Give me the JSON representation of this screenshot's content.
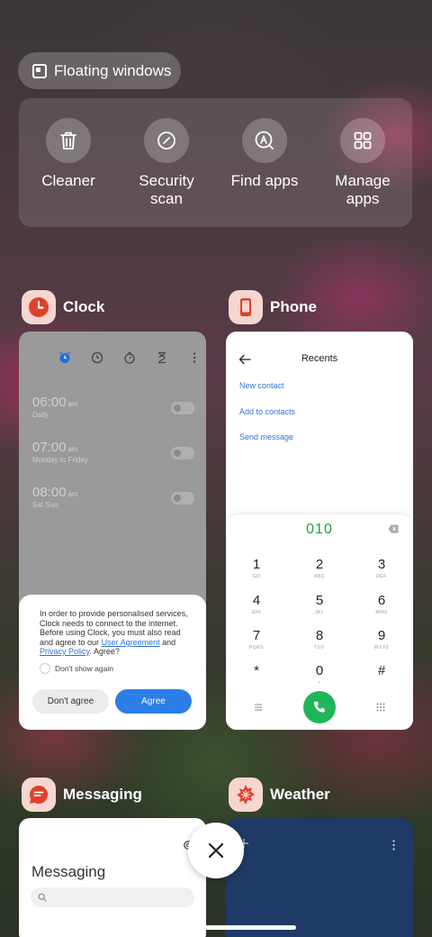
{
  "floating_windows": {
    "label": "Floating windows",
    "icon": "floating-window-icon"
  },
  "quick_actions": [
    {
      "label": "Cleaner",
      "icon": "trash-icon"
    },
    {
      "label": "Security\nscan",
      "icon": "security-scan-icon"
    },
    {
      "label": "Find apps",
      "icon": "find-apps-icon"
    },
    {
      "label": "Manage\napps",
      "icon": "grid-icon"
    }
  ],
  "apps": {
    "clock": {
      "name": "Clock",
      "icon": "clock-icon",
      "alarms": [
        {
          "time": "06:00",
          "ampm": "am",
          "repeat": "Daily"
        },
        {
          "time": "07:00",
          "ampm": "am",
          "repeat": "Monday to Friday"
        },
        {
          "time": "08:00",
          "ampm": "am",
          "repeat": "Sat Sun"
        }
      ],
      "consent": {
        "text_before": "In order to provide personalised services, Clock needs to connect to the internet. Before using Clock, you must also read and agree to our ",
        "link1": "User Agreement",
        "and": " and ",
        "link2": "Privacy Policy",
        "text_after": ". Agree?",
        "checkbox": "Don't show again",
        "decline": "Don't agree",
        "accept": "Agree"
      }
    },
    "phone": {
      "name": "Phone",
      "icon": "phone-icon",
      "title": "Recents",
      "links": [
        "New contact",
        "Add to contacts",
        "Send message"
      ],
      "dialed": "010",
      "keys": [
        {
          "d": "1",
          "l": "GD"
        },
        {
          "d": "2",
          "l": "ABC"
        },
        {
          "d": "3",
          "l": "DEF"
        },
        {
          "d": "4",
          "l": "GHI"
        },
        {
          "d": "5",
          "l": "JKL"
        },
        {
          "d": "6",
          "l": "MNO"
        },
        {
          "d": "7",
          "l": "PQRS"
        },
        {
          "d": "8",
          "l": "TUV"
        },
        {
          "d": "9",
          "l": "WXYZ"
        },
        {
          "d": "*",
          "l": ","
        },
        {
          "d": "0",
          "l": "+"
        },
        {
          "d": "#",
          "l": ""
        }
      ]
    },
    "messaging": {
      "name": "Messaging",
      "icon": "message-icon",
      "title": "Messaging"
    },
    "weather": {
      "name": "Weather",
      "icon": "weather-icon"
    }
  },
  "colors": {
    "accent_blue": "#2c7fe6",
    "call_green": "#1fb55a",
    "dial_green": "#1aa34a",
    "app_icon_red": "#e0402a"
  }
}
